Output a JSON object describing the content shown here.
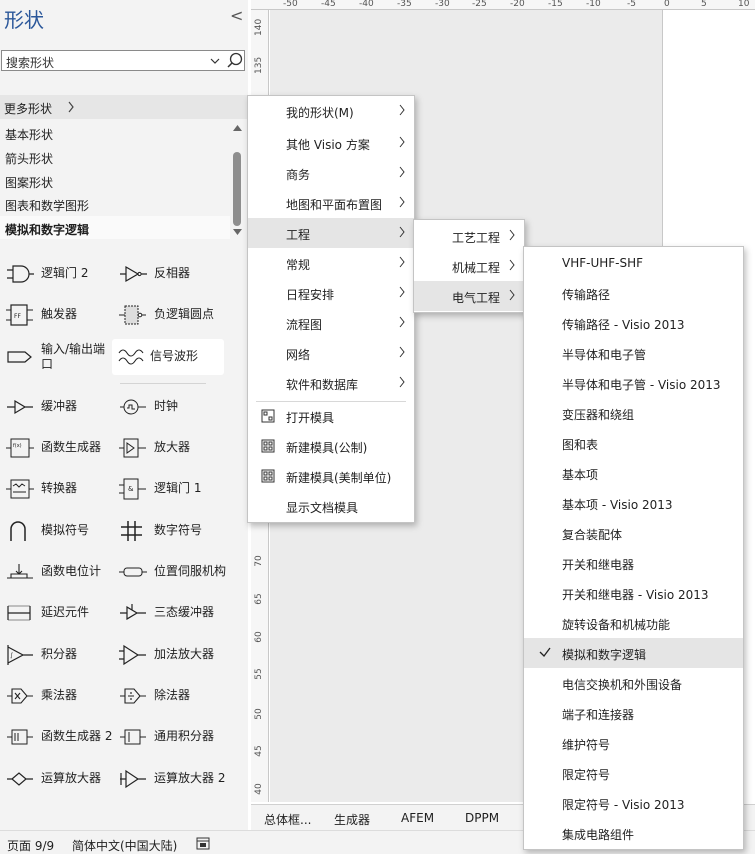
{
  "pane": {
    "title": "形状",
    "collapse_glyph": "<",
    "search_placeholder": "搜索形状",
    "more_shapes": "更多形状",
    "stencils": [
      "基本形状",
      "箭头形状",
      "图案形状",
      "图表和数学图形",
      "模拟和数字逻辑"
    ],
    "active_stencil": "模拟和数字逻辑",
    "shapes": [
      {
        "label": "逻辑门 2",
        "icon": "logic-gate-icon"
      },
      {
        "label": "反相器",
        "icon": "inverter-icon"
      },
      {
        "label": "触发器",
        "icon": "flip-flop-icon"
      },
      {
        "label": "负逻辑圆点",
        "icon": "negative-logic-dot-icon"
      },
      {
        "label": "输入/输出端口",
        "icon": "io-port-icon"
      },
      {
        "label": "信号波形",
        "icon": "signal-waveform-icon"
      },
      {
        "label": "缓冲器",
        "icon": "buffer-icon"
      },
      {
        "label": "时钟",
        "icon": "clock-icon"
      },
      {
        "label": "函数生成器",
        "icon": "function-generator-icon"
      },
      {
        "label": "放大器",
        "icon": "amplifier-icon"
      },
      {
        "label": "转换器",
        "icon": "converter-icon"
      },
      {
        "label": "逻辑门 1",
        "icon": "logic-gate-1-icon"
      },
      {
        "label": "模拟符号",
        "icon": "analog-symbol-icon"
      },
      {
        "label": "数字符号",
        "icon": "digital-symbol-icon"
      },
      {
        "label": "函数电位计",
        "icon": "potentiometer-icon"
      },
      {
        "label": "位置伺服机构",
        "icon": "servo-icon"
      },
      {
        "label": "延迟元件",
        "icon": "delay-element-icon"
      },
      {
        "label": "三态缓冲器",
        "icon": "tristate-buffer-icon"
      },
      {
        "label": "积分器",
        "icon": "integrator-icon"
      },
      {
        "label": "加法放大器",
        "icon": "summing-amplifier-icon"
      },
      {
        "label": "乘法器",
        "icon": "multiplier-icon"
      },
      {
        "label": "除法器",
        "icon": "divider-icon"
      },
      {
        "label": "函数生成器 2",
        "icon": "function-generator-2-icon"
      },
      {
        "label": "通用积分器",
        "icon": "general-integrator-icon"
      },
      {
        "label": "运算放大器",
        "icon": "op-amp-icon"
      },
      {
        "label": "运算放大器 2",
        "icon": "op-amp-2-icon"
      }
    ]
  },
  "rulers": {
    "horizontal": [
      "-50",
      "-45",
      "-40",
      "-35",
      "-30",
      "-25",
      "-20",
      "-15",
      "-10",
      "-5",
      "0",
      "5",
      "10"
    ],
    "vertical": [
      "140",
      "135",
      "70",
      "65",
      "60",
      "55",
      "50",
      "45",
      "40"
    ]
  },
  "menu1": {
    "items": [
      {
        "label": "我的形状(M)",
        "sub": true
      },
      {
        "label": "其他 Visio 方案",
        "sub": true
      },
      {
        "label": "商务",
        "sub": true
      },
      {
        "label": "地图和平面布置图",
        "sub": true
      },
      {
        "label": "工程",
        "sub": true,
        "highlight": true
      },
      {
        "label": "常规",
        "sub": true
      },
      {
        "label": "日程安排",
        "sub": true
      },
      {
        "label": "流程图",
        "sub": true
      },
      {
        "label": "网络",
        "sub": true
      },
      {
        "label": "软件和数据库",
        "sub": true
      }
    ],
    "actions": [
      {
        "label": "打开模具",
        "icon": "open-stencil-icon"
      },
      {
        "label": "新建模具(公制)",
        "icon": "new-stencil-icon"
      },
      {
        "label": "新建模具(美制单位)",
        "icon": "new-stencil-us-icon"
      },
      {
        "label": "显示文档模具",
        "icon": ""
      }
    ]
  },
  "menu2": {
    "items": [
      {
        "label": "工艺工程",
        "highlight": false
      },
      {
        "label": "机械工程",
        "highlight": false
      },
      {
        "label": "电气工程",
        "highlight": true
      }
    ]
  },
  "menu3": {
    "items": [
      "VHF-UHF-SHF",
      "传输路径",
      "传输路径 - Visio 2013",
      "半导体和电子管",
      "半导体和电子管 - Visio 2013",
      "变压器和绕组",
      "图和表",
      "基本项",
      "基本项 - Visio 2013",
      "复合装配体",
      "开关和继电器",
      "开关和继电器 - Visio 2013",
      "旋转设备和机械功能",
      "模拟和数字逻辑",
      "电信交换机和外围设备",
      "端子和连接器",
      "维护符号",
      "限定符号",
      "限定符号 - Visio 2013",
      "集成电路组件"
    ],
    "checked": "模拟和数字逻辑"
  },
  "tabs": [
    "总体框...",
    "生成器",
    "AFEM",
    "DPPM"
  ],
  "status": {
    "page": "页面 9/9",
    "language": "简体中文(中国大陆)"
  },
  "colors": {
    "accent": "#2b579a",
    "highlight": "#e5e5e5"
  }
}
